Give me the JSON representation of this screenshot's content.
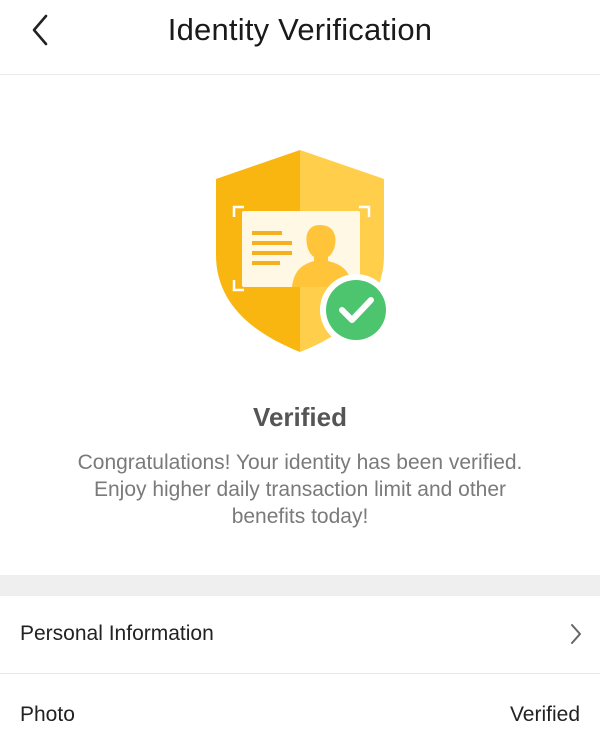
{
  "header": {
    "title": "Identity Verification",
    "back_icon": "chevron-left-icon"
  },
  "hero": {
    "illustration_icon": "shield-id-card-icon",
    "check_icon": "check-circle-icon",
    "status_title": "Verified",
    "status_description": "Congratulations! Your identity has been verified. Enjoy higher daily transaction limit and other benefits today!"
  },
  "rows": {
    "personal_information": {
      "label": "Personal Information",
      "icon": "chevron-right-icon"
    },
    "photo": {
      "label": "Photo",
      "value": "Verified"
    }
  },
  "colors": {
    "shield_left": "#F9B611",
    "shield_right": "#FFCE4A",
    "check_green": "#4CC56E",
    "divider": "#EFEFEF",
    "text_muted": "#7A7A7A"
  }
}
